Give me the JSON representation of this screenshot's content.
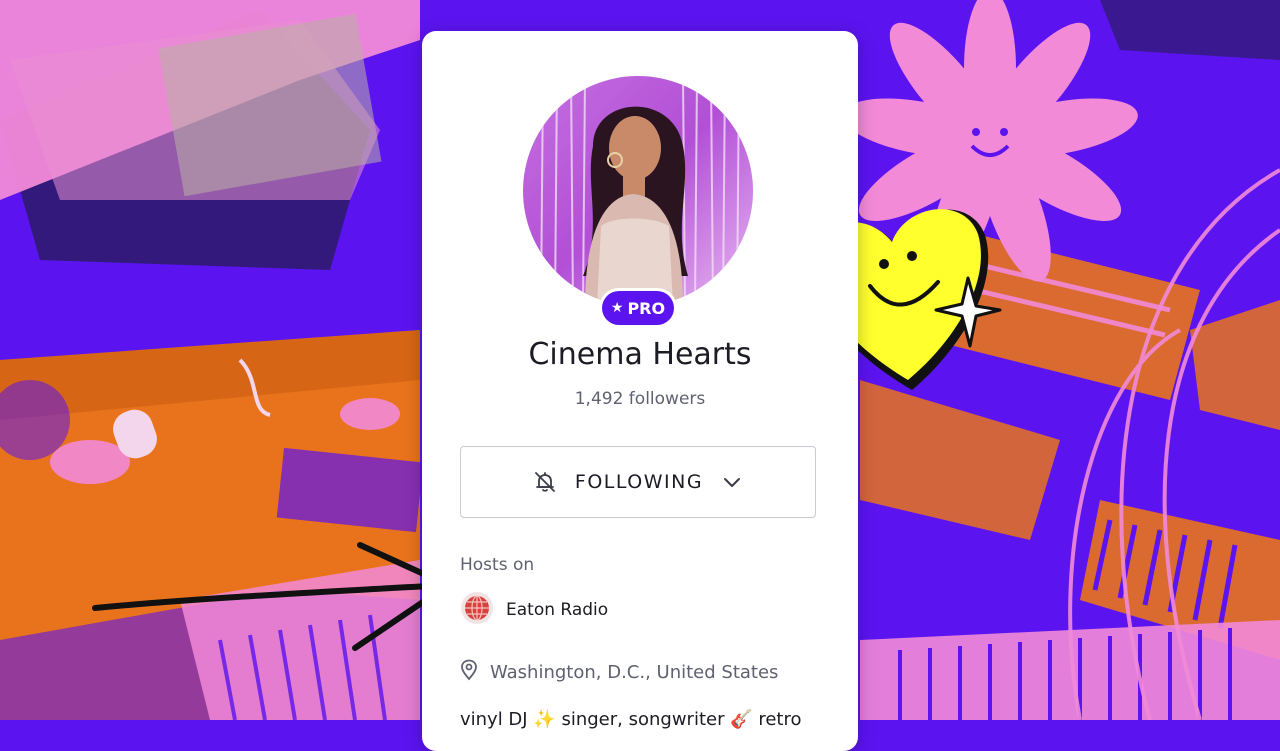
{
  "profile": {
    "badge_label": "PRO",
    "badge_icon": "star-icon",
    "name": "Cinema Hearts",
    "followers": "1,492 followers",
    "follow_button_label": "FOLLOWING",
    "hosts_label": "Hosts on",
    "station_name": "Eaton Radio",
    "location": "Washington, D.C., United States",
    "bio": "vinyl DJ ✨ singer, songwriter 🎸 retro"
  },
  "colors": {
    "background": "#5b14f0",
    "accent": "#5b14f0",
    "card": "#ffffff",
    "orange_overlay": "#f07a1e",
    "pink_overlay": "#f28ad8",
    "heart_sticker": "#ffff2e"
  },
  "icons": [
    "bell-off-icon",
    "chevron-down-icon",
    "globe-icon",
    "location-pin-icon",
    "smiley-heart-icon",
    "sparkle-icon",
    "arrow-doodle",
    "smiley-flower"
  ]
}
